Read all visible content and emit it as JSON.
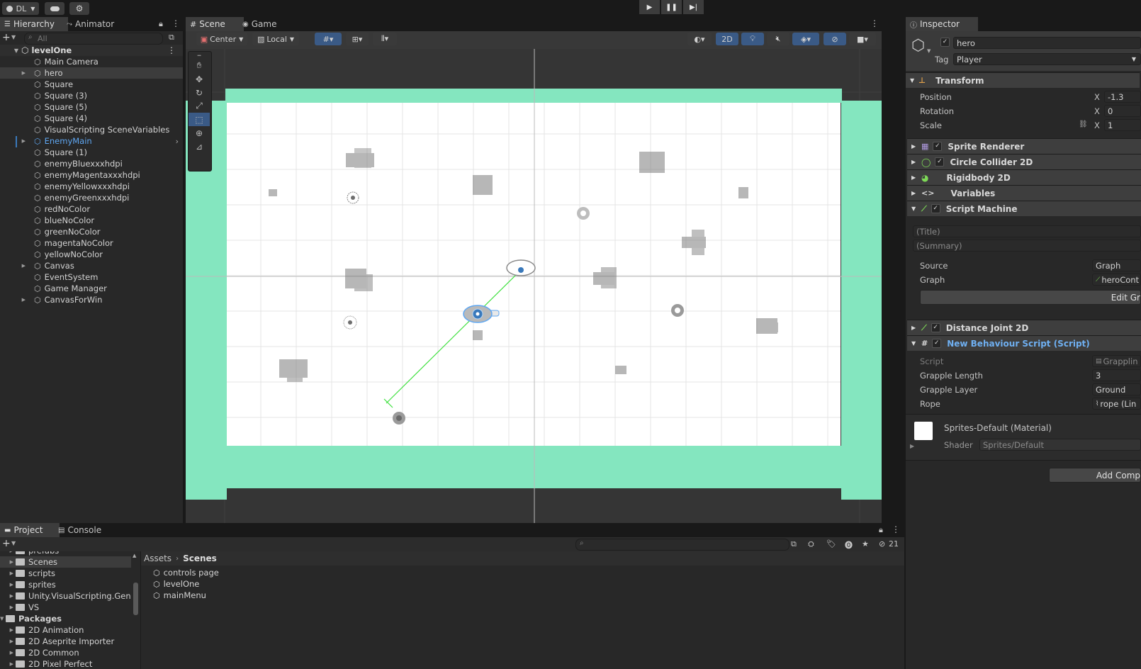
{
  "toolbar": {
    "account_label": "DL",
    "play_icon": "play-icon",
    "pause_icon": "pause-icon",
    "step_icon": "step-icon"
  },
  "hierarchy": {
    "tab_label": "Hierarchy",
    "animator_tab_label": "Animator",
    "search_placeholder": "All",
    "scene_name": "levelOne",
    "items": [
      {
        "label": "Main Camera",
        "expandable": false,
        "selected": false,
        "prefab": false
      },
      {
        "label": "hero",
        "expandable": true,
        "selected": true,
        "prefab": false
      },
      {
        "label": "Square",
        "expandable": false,
        "selected": false,
        "prefab": false
      },
      {
        "label": "Square (3)",
        "expandable": false,
        "selected": false,
        "prefab": false
      },
      {
        "label": "Square (5)",
        "expandable": false,
        "selected": false,
        "prefab": false
      },
      {
        "label": "Square (4)",
        "expandable": false,
        "selected": false,
        "prefab": false
      },
      {
        "label": "VisualScripting SceneVariables",
        "expandable": false,
        "selected": false,
        "prefab": false
      },
      {
        "label": "EnemyMain",
        "expandable": true,
        "selected": false,
        "prefab": true
      },
      {
        "label": "Square (1)",
        "expandable": false,
        "selected": false,
        "prefab": false
      },
      {
        "label": "enemyBluexxxhdpi",
        "expandable": false,
        "selected": false,
        "prefab": false
      },
      {
        "label": "enemyMagentaxxxhdpi",
        "expandable": false,
        "selected": false,
        "prefab": false
      },
      {
        "label": "enemyYellowxxxhdpi",
        "expandable": false,
        "selected": false,
        "prefab": false
      },
      {
        "label": "enemyGreenxxxhdpi",
        "expandable": false,
        "selected": false,
        "prefab": false
      },
      {
        "label": "redNoColor",
        "expandable": false,
        "selected": false,
        "prefab": false
      },
      {
        "label": "blueNoColor",
        "expandable": false,
        "selected": false,
        "prefab": false
      },
      {
        "label": "greenNoColor",
        "expandable": false,
        "selected": false,
        "prefab": false
      },
      {
        "label": "magentaNoColor",
        "expandable": false,
        "selected": false,
        "prefab": false
      },
      {
        "label": "yellowNoColor",
        "expandable": false,
        "selected": false,
        "prefab": false
      },
      {
        "label": "Canvas",
        "expandable": true,
        "selected": false,
        "prefab": false
      },
      {
        "label": "EventSystem",
        "expandable": false,
        "selected": false,
        "prefab": false
      },
      {
        "label": "Game Manager",
        "expandable": false,
        "selected": false,
        "prefab": false
      },
      {
        "label": "CanvasForWin",
        "expandable": true,
        "selected": false,
        "prefab": false
      }
    ]
  },
  "scene": {
    "scene_tab_label": "Scene",
    "game_tab_label": "Game",
    "pivot_label": "Center",
    "space_label": "Local",
    "mode_2d_label": "2D"
  },
  "inspector": {
    "tab_label": "Inspector",
    "object_name": "hero",
    "tag_label": "Tag",
    "tag_value": "Player",
    "transform": {
      "title": "Transform",
      "position_label": "Position",
      "position_x": "-1.3",
      "rotation_label": "Rotation",
      "rotation_z": "0",
      "scale_label": "Scale",
      "scale_x": "1",
      "axis_label": "X"
    },
    "components": {
      "sprite_renderer": "Sprite Renderer",
      "circle_collider": "Circle Collider 2D",
      "rigidbody": "Rigidbody 2D",
      "variables": "Variables",
      "script_machine": "Script Machine",
      "distance_joint": "Distance Joint 2D",
      "new_behaviour": "New Behaviour Script (Script)"
    },
    "script_machine": {
      "title_placeholder": "(Title)",
      "summary_placeholder": "(Summary)",
      "source_label": "Source",
      "source_value": "Graph",
      "graph_label": "Graph",
      "graph_value": "heroCont",
      "edit_graph_label": "Edit Gr"
    },
    "behaviour": {
      "script_label": "Script",
      "script_value": "Grapplin",
      "grapple_length_label": "Grapple Length",
      "grapple_length_value": "3",
      "grapple_layer_label": "Grapple Layer",
      "grapple_layer_value": "Ground",
      "rope_label": "Rope",
      "rope_value": "rope (Lin"
    },
    "material": {
      "name": "Sprites-Default (Material)",
      "shader_label": "Shader",
      "shader_value": "Sprites/Default"
    },
    "add_component_label": "Add Comp"
  },
  "project": {
    "tab_label": "Project",
    "console_tab_label": "Console",
    "hidden_count": "21",
    "folders": [
      {
        "label": "prefabs",
        "indent": 1,
        "selected": false
      },
      {
        "label": "Scenes",
        "indent": 1,
        "selected": true
      },
      {
        "label": "scripts",
        "indent": 1,
        "selected": false
      },
      {
        "label": "sprites",
        "indent": 1,
        "selected": false
      },
      {
        "label": "Unity.VisualScripting.Gen",
        "indent": 1,
        "selected": false
      },
      {
        "label": "VS",
        "indent": 1,
        "selected": false
      },
      {
        "label": "Packages",
        "indent": 0,
        "selected": false
      },
      {
        "label": "2D Animation",
        "indent": 1,
        "selected": false
      },
      {
        "label": "2D Aseprite Importer",
        "indent": 1,
        "selected": false
      },
      {
        "label": "2D Common",
        "indent": 1,
        "selected": false
      },
      {
        "label": "2D Pixel Perfect",
        "indent": 1,
        "selected": false
      }
    ],
    "breadcrumb_root": "Assets",
    "breadcrumb_current": "Scenes",
    "files": [
      "controls page",
      "levelOne",
      "mainMenu"
    ]
  },
  "colors": {
    "accent_blue": "#3a79bb",
    "teal_ground": "#84e6bf",
    "prefab_blue": "#5fa7f2"
  }
}
